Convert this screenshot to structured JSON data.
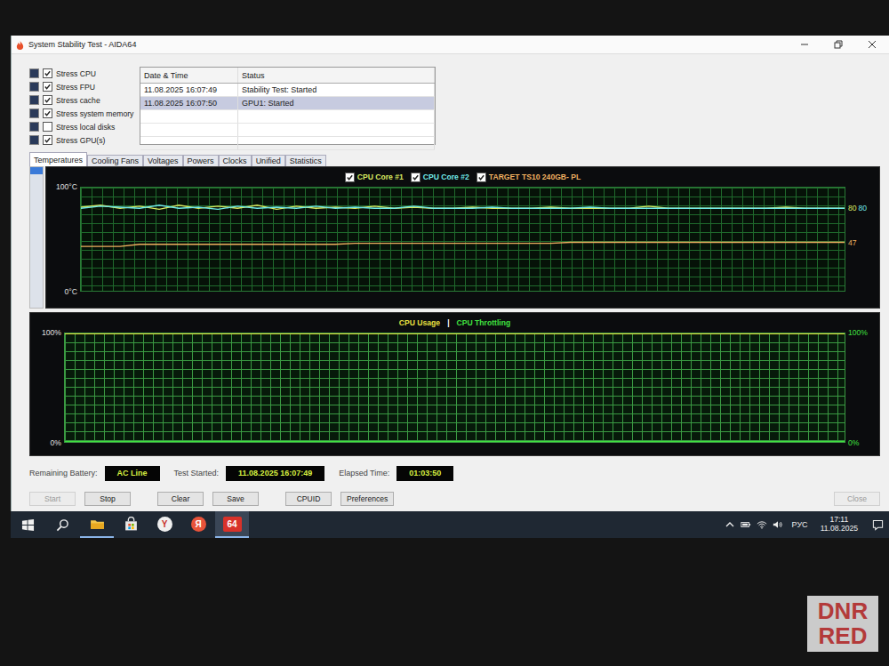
{
  "window": {
    "title": "System Stability Test - AIDA64"
  },
  "stress_options": [
    {
      "label": "Stress CPU",
      "checked": true
    },
    {
      "label": "Stress FPU",
      "checked": true
    },
    {
      "label": "Stress cache",
      "checked": true
    },
    {
      "label": "Stress system memory",
      "checked": true
    },
    {
      "label": "Stress local disks",
      "checked": false
    },
    {
      "label": "Stress GPU(s)",
      "checked": true
    }
  ],
  "log": {
    "columns": [
      "Date & Time",
      "Status"
    ],
    "rows": [
      {
        "time": "11.08.2025 16:07:49",
        "status": "Stability Test: Started",
        "selected": false
      },
      {
        "time": "11.08.2025 16:07:50",
        "status": "GPU1: Started",
        "selected": true
      }
    ]
  },
  "tabs": [
    {
      "label": "Temperatures",
      "selected": true
    },
    {
      "label": "Cooling Fans",
      "selected": false
    },
    {
      "label": "Voltages",
      "selected": false
    },
    {
      "label": "Powers",
      "selected": false
    },
    {
      "label": "Clocks",
      "selected": false
    },
    {
      "label": "Unified",
      "selected": false
    },
    {
      "label": "Statistics",
      "selected": false
    }
  ],
  "temperature_chart": {
    "y_max": "100°C",
    "y_min": "0°C",
    "axis_max": 100,
    "series": [
      {
        "name": "CPU Core #1",
        "checked": true,
        "color": "#d8e860",
        "reading": "80",
        "values": [
          81,
          83,
          80,
          82,
          79,
          83,
          80,
          82,
          80,
          83,
          79,
          82,
          80,
          81,
          80,
          82,
          80,
          81,
          80,
          80,
          81,
          80,
          80,
          80,
          81,
          80,
          80,
          80,
          80,
          82,
          80,
          80,
          80,
          80,
          80,
          80,
          81,
          80,
          80,
          80
        ]
      },
      {
        "name": "CPU Core #2",
        "checked": true,
        "color": "#70e8e8",
        "reading": "80",
        "values": [
          80,
          82,
          81,
          80,
          83,
          80,
          81,
          79,
          82,
          80,
          81,
          80,
          82,
          80,
          81,
          80,
          80,
          82,
          80,
          80,
          80,
          81,
          80,
          80,
          80,
          80,
          81,
          80,
          80,
          80,
          80,
          80,
          80,
          80,
          80,
          80,
          80,
          80,
          80,
          80
        ]
      },
      {
        "name": "TARGET TS10 240GB- PL",
        "checked": true,
        "color": "#f0b060",
        "reading": "47",
        "values": [
          43,
          43,
          43,
          45,
          45,
          45,
          45,
          45,
          45,
          45,
          45,
          45,
          45,
          45,
          46,
          46,
          46,
          46,
          46,
          46,
          46,
          46,
          46,
          46,
          46,
          47,
          47,
          47,
          47,
          47,
          47,
          47,
          47,
          47,
          47,
          47,
          47,
          47,
          47,
          47
        ]
      }
    ]
  },
  "usage_chart": {
    "y_max": "100%",
    "y_min": "0%",
    "right_max": "100%",
    "right_min": "0%",
    "axis_max": 100,
    "separator": "|",
    "series": [
      {
        "name": "CPU Usage",
        "color": "#e8e040",
        "values": [
          100,
          100,
          100,
          100,
          100,
          100,
          100,
          100,
          100,
          100,
          100,
          100,
          100,
          100,
          100,
          100,
          100,
          100,
          100,
          100
        ]
      },
      {
        "name": "CPU Throttling",
        "color": "#40e040",
        "values": [
          0,
          0,
          0,
          0,
          0,
          0,
          0,
          0,
          0,
          0,
          0,
          0,
          0,
          0,
          0,
          0,
          0,
          0,
          0,
          0
        ]
      }
    ]
  },
  "status": [
    {
      "label": "Remaining Battery:",
      "value": "AC Line"
    },
    {
      "label": "Test Started:",
      "value": "11.08.2025 16:07:49"
    },
    {
      "label": "Elapsed Time:",
      "value": "01:03:50"
    }
  ],
  "buttons": [
    {
      "label": "Start",
      "disabled": true
    },
    {
      "label": "Stop",
      "disabled": false
    },
    {
      "label": "Clear",
      "disabled": false
    },
    {
      "label": "Save",
      "disabled": false
    },
    {
      "label": "CPUID",
      "disabled": false
    },
    {
      "label": "Preferences",
      "disabled": false
    },
    {
      "label": "Close",
      "disabled": true
    }
  ],
  "taskbar": {
    "apps": [
      {
        "kind": "explorer",
        "running": true,
        "active": false
      },
      {
        "kind": "store",
        "running": false,
        "active": false
      },
      {
        "kind": "letter",
        "label": "Y",
        "color": "#f0f0f0",
        "running": false,
        "active": false
      },
      {
        "kind": "letter",
        "label": "Я",
        "color": "#e8533a",
        "running": false,
        "active": false
      },
      {
        "kind": "letter",
        "label": "64",
        "color": "#d8322a",
        "running": true,
        "active": true
      }
    ],
    "language": "РУС",
    "time": "17:11",
    "date": "11.08.2025"
  },
  "watermark": [
    "DNR",
    "RED"
  ]
}
